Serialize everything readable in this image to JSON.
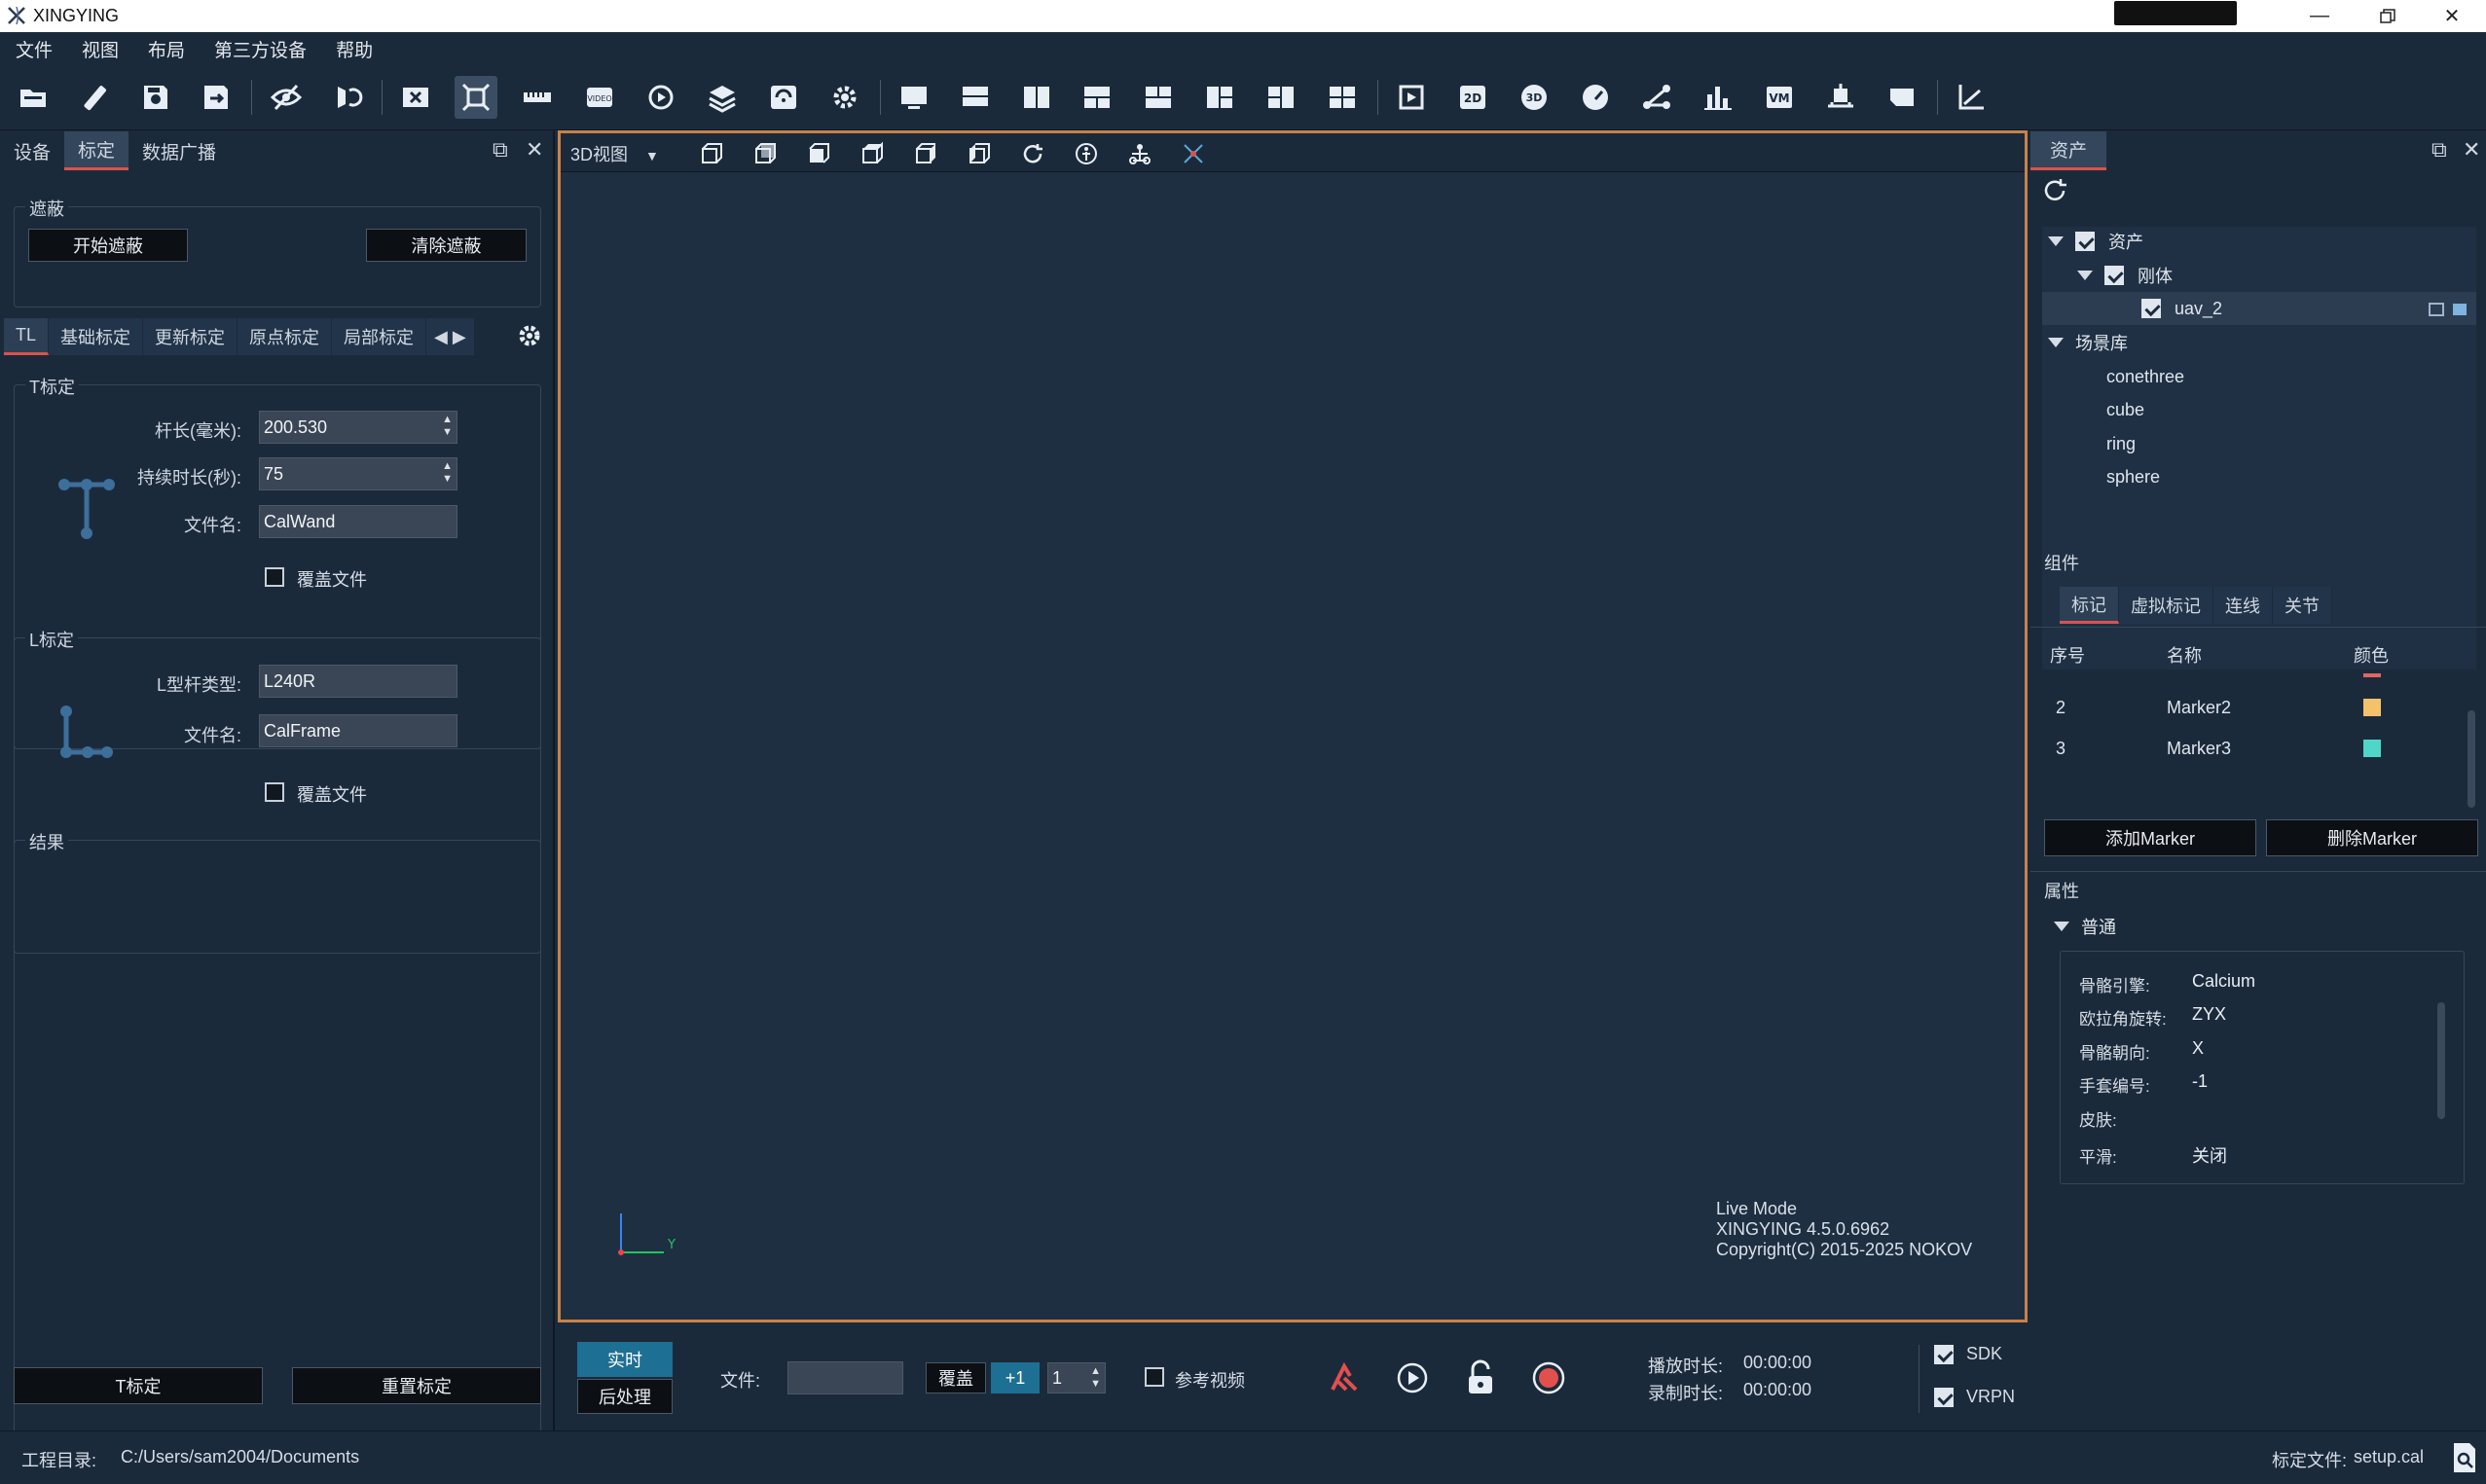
{
  "app": {
    "title": "XINGYING"
  },
  "menu": [
    "文件",
    "视图",
    "布局",
    "第三方设备",
    "帮助"
  ],
  "toolbar_icons": [
    "open-folder-icon",
    "wand-icon",
    "save-icon",
    "save-as-icon",
    "hide-eye-icon",
    "mirror-icon",
    "camera-video-icon",
    "calibrate-icon",
    "ruler-icon",
    "video-icon",
    "refresh-play-icon",
    "layers-icon",
    "network-icon",
    "settings-gear-icon",
    "monitor-icon",
    "layout-1-icon",
    "layout-2-icon",
    "layout-3-icon",
    "layout-4-icon",
    "layout-5-icon",
    "layout-6-icon",
    "layout-7-icon",
    "video-replay-icon",
    "2d-icon",
    "3d-icon",
    "gauge-icon",
    "skeleton-icon",
    "chart-bar-icon",
    "vm-icon",
    "device-icon",
    "tag-icon",
    "axis-icon"
  ],
  "left": {
    "tabs": [
      "设备",
      "标定",
      "数据广播"
    ],
    "mask": {
      "title": "遮蔽",
      "start": "开始遮蔽",
      "clear": "清除遮蔽"
    },
    "subtabs": [
      "TL",
      "基础标定",
      "更新标定",
      "原点标定",
      "局部标定"
    ],
    "t": {
      "title": "T标定",
      "rod_label": "杆长(毫米):",
      "rod_value": "200.530",
      "duration_label": "持续时长(秒):",
      "duration_value": "75",
      "file_label": "文件名:",
      "file_value": "CalWand",
      "overwrite": "覆盖文件"
    },
    "l": {
      "title": "L标定",
      "type_label": "L型杆类型:",
      "type_value": "L240R",
      "file_label": "文件名:",
      "file_value": "CalFrame",
      "overwrite": "覆盖文件"
    },
    "result": {
      "title": "结果"
    },
    "btn_t": "T标定",
    "btn_reset": "重置标定"
  },
  "view": {
    "mode_label": "3D视图",
    "axis_y": "Y",
    "info": [
      "Live Mode",
      "XINGYING 4.5.0.6962",
      "Copyright(C) 2015-2025 NOKOV"
    ]
  },
  "bottom": {
    "realtime": "实时",
    "postprocess": "后处理",
    "file_label": "文件:",
    "file_value": "",
    "overwrite": "覆盖",
    "plus_one": "+1",
    "counter": "1",
    "ref_video": "参考视频",
    "play_label": "播放时长:",
    "play_value": "00:00:00",
    "rec_label": "录制时长:",
    "rec_value": "00:00:00",
    "sdk": "SDK",
    "vrpn": "VRPN"
  },
  "right": {
    "tab": "资产",
    "tree": {
      "assets": "资产",
      "rigid": "刚体",
      "uav": "uav_2",
      "scene_lib": "场景库",
      "scene_items": [
        "conethree",
        "cube",
        "ring",
        "sphere"
      ]
    },
    "components": {
      "title": "组件",
      "tabs": [
        "标记",
        "虚拟标记",
        "连线",
        "关节"
      ],
      "headers": [
        "序号",
        "名称",
        "颜色"
      ],
      "rows": [
        {
          "index": "2",
          "name": "Marker2",
          "color": "#f4c26b"
        },
        {
          "index": "3",
          "name": "Marker3",
          "color": "#4fd6c8"
        }
      ],
      "add": "添加Marker",
      "remove": "删除Marker"
    },
    "props": {
      "title": "属性",
      "section": "普通",
      "items": [
        {
          "label": "骨骼引擎:",
          "value": "Calcium"
        },
        {
          "label": "欧拉角旋转:",
          "value": "ZYX"
        },
        {
          "label": "骨骼朝向:",
          "value": "X"
        },
        {
          "label": "手套编号:",
          "value": "-1"
        },
        {
          "label": "皮肤:",
          "value": ""
        },
        {
          "label": "平滑:",
          "value": "关闭"
        }
      ]
    }
  },
  "status": {
    "project_label": "工程目录:",
    "project_path": "C:/Users/sam2004/Documents",
    "cal_label": "标定文件:",
    "cal_value": "setup.cal"
  },
  "colors": {
    "accent_red": "#d9534f",
    "frame_orange": "#c8824a",
    "blue_btn": "#1d6f93",
    "record": "#e2504d"
  }
}
